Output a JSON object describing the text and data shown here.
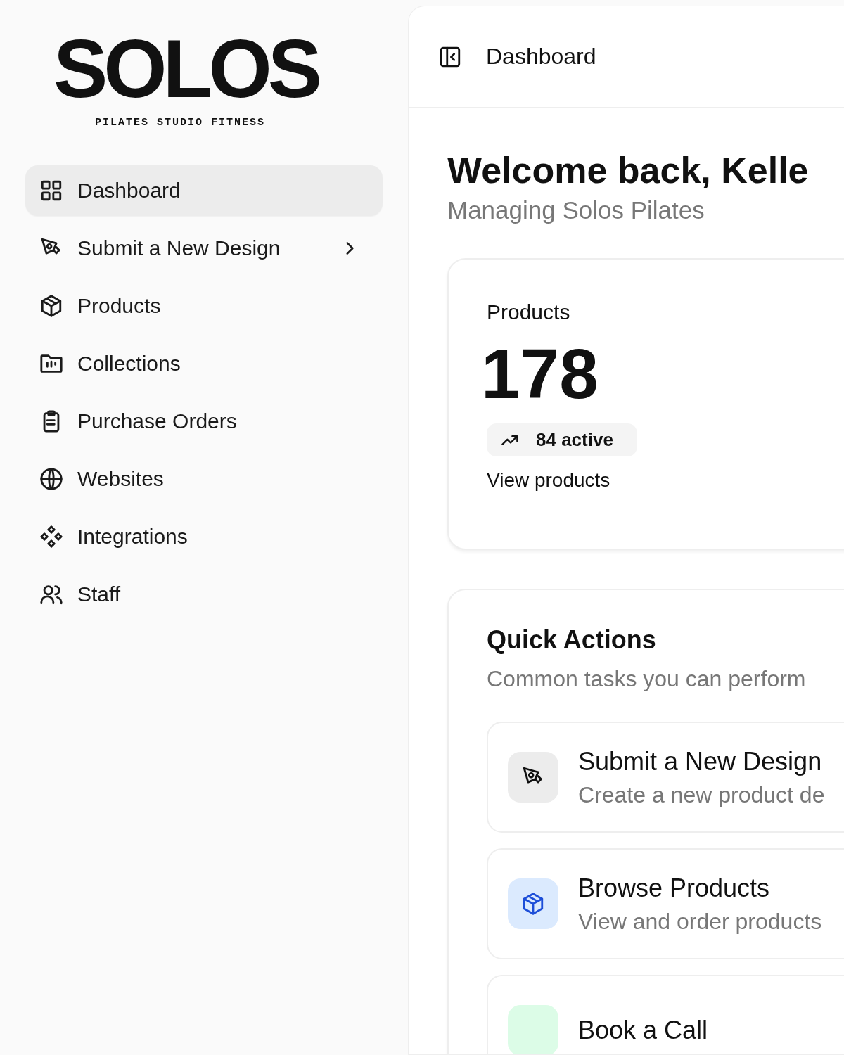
{
  "logo": {
    "wordmark": "SOLOS",
    "tagline": "PILATES STUDIO FITNESS"
  },
  "sidebar": {
    "items": [
      {
        "label": "Dashboard",
        "kind": "grid",
        "selected": true,
        "has_submenu": false
      },
      {
        "label": "Submit a New Design",
        "kind": "pen",
        "selected": false,
        "has_submenu": true
      },
      {
        "label": "Products",
        "kind": "box",
        "selected": false,
        "has_submenu": false
      },
      {
        "label": "Collections",
        "kind": "folder",
        "selected": false,
        "has_submenu": false
      },
      {
        "label": "Purchase Orders",
        "kind": "clipboard",
        "selected": false,
        "has_submenu": false
      },
      {
        "label": "Websites",
        "kind": "globe",
        "selected": false,
        "has_submenu": false
      },
      {
        "label": "Integrations",
        "kind": "diamonds",
        "selected": false,
        "has_submenu": false
      },
      {
        "label": "Staff",
        "kind": "users",
        "selected": false,
        "has_submenu": false
      }
    ]
  },
  "header": {
    "title": "Dashboard"
  },
  "welcome": {
    "title": "Welcome back, Kelle",
    "subtitle": "Managing Solos Pilates"
  },
  "stat_card": {
    "label": "Products",
    "value": "178",
    "badge": "84 active",
    "link": "View products"
  },
  "quick_actions": {
    "title": "Quick Actions",
    "subtitle": "Common tasks you can perform",
    "items": [
      {
        "title": "Submit a New Design",
        "description": "Create a new product de",
        "kind": "pen",
        "color": "#ececec"
      },
      {
        "title": "Browse Products",
        "description": "View and order products",
        "kind": "box",
        "color": "#dbeafe"
      },
      {
        "title": "Book a Call",
        "color": "#dcfce7"
      }
    ]
  }
}
